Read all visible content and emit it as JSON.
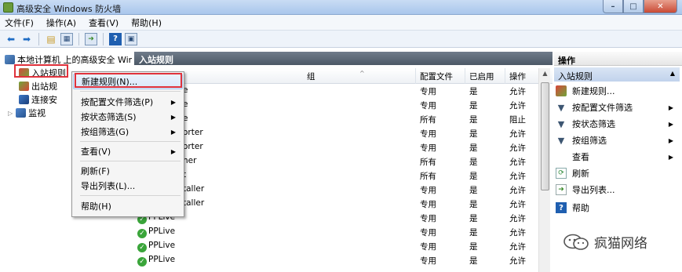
{
  "window": {
    "title": "高级安全 Windows 防火墙"
  },
  "menubar": {
    "items": [
      "文件(F)",
      "操作(A)",
      "查看(V)",
      "帮助(H)"
    ]
  },
  "tree": {
    "root": "本地计算机 上的高级安全 Windo",
    "inbound": "入站规则",
    "outbound": "出站规",
    "connection": "连接安",
    "monitor": "监视"
  },
  "middle": {
    "header": "入站规则",
    "columns": {
      "group": "组",
      "profile": "配置文件",
      "enabled": "已启用",
      "action": "操作"
    },
    "rows": [
      {
        "name": "e",
        "profile": "专用",
        "enabled": "是",
        "action": "允许"
      },
      {
        "name": "e",
        "profile": "专用",
        "enabled": "是",
        "action": "允许"
      },
      {
        "name": "e",
        "profile": "所有",
        "enabled": "是",
        "action": "阻止"
      },
      {
        "name": "orter",
        "profile": "专用",
        "enabled": "是",
        "action": "允许"
      },
      {
        "name": "orter",
        "profile": "专用",
        "enabled": "是",
        "action": "允许"
      },
      {
        "name": "her",
        "profile": "所有",
        "enabled": "是",
        "action": "允许"
      },
      {
        "name": "t",
        "profile": "所有",
        "enabled": "是",
        "action": "允许"
      },
      {
        "name": "taller",
        "profile": "专用",
        "enabled": "是",
        "action": "允许"
      },
      {
        "name": "taller",
        "profile": "专用",
        "enabled": "是",
        "action": "允许"
      },
      {
        "name": "PPLive",
        "profile": "专用",
        "enabled": "是",
        "action": "允许"
      },
      {
        "name": "PPLive",
        "profile": "专用",
        "enabled": "是",
        "action": "允许"
      },
      {
        "name": "PPLive",
        "profile": "专用",
        "enabled": "是",
        "action": "允许"
      },
      {
        "name": "PPLive",
        "profile": "专用",
        "enabled": "是",
        "action": "允许"
      }
    ]
  },
  "context_menu": {
    "new_rule": "新建规则(N)...",
    "filter_profile": "按配置文件筛选(P)",
    "filter_state": "按状态筛选(S)",
    "filter_group": "按组筛选(G)",
    "view": "查看(V)",
    "refresh": "刷新(F)",
    "export": "导出列表(L)...",
    "help": "帮助(H)"
  },
  "actions": {
    "header": "操作",
    "section": "入站规则",
    "items": [
      "新建规则...",
      "按配置文件筛选",
      "按状态筛选",
      "按组筛选",
      "查看",
      "刷新",
      "导出列表...",
      "帮助"
    ]
  },
  "watermark": {
    "text": "疯猫网络"
  },
  "colors": {
    "highlight_red": "#e0323c",
    "header_dark": "#5a6674",
    "accent_blue": "#1f5fb0"
  }
}
